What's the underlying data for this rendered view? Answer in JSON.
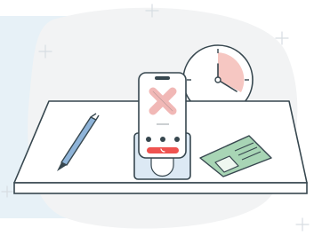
{
  "illustration": {
    "subject": "missed-call-on-desk",
    "elements": [
      "desk",
      "smartphone",
      "wall-clock",
      "pen",
      "id-card"
    ],
    "colors": {
      "backdrop": "#e7f1f7",
      "blob": "#f2f3f4",
      "outline": "#37474f",
      "phone_screen": "#ffffff",
      "phone_dock": "#dce9f4",
      "x_mark": "#f1b8b6",
      "call_button": "#ef5350",
      "clock_sector": "#f6c7c2",
      "pen_body": "#8fb4d9",
      "card_fill": "#a8d5b5",
      "card_photo": "#eef7f0",
      "sparkle": "#d7dde2"
    },
    "icons": [
      "x-icon",
      "phone-icon",
      "clock-icon",
      "pen-icon",
      "id-card-icon",
      "sparkle-icon"
    ]
  }
}
